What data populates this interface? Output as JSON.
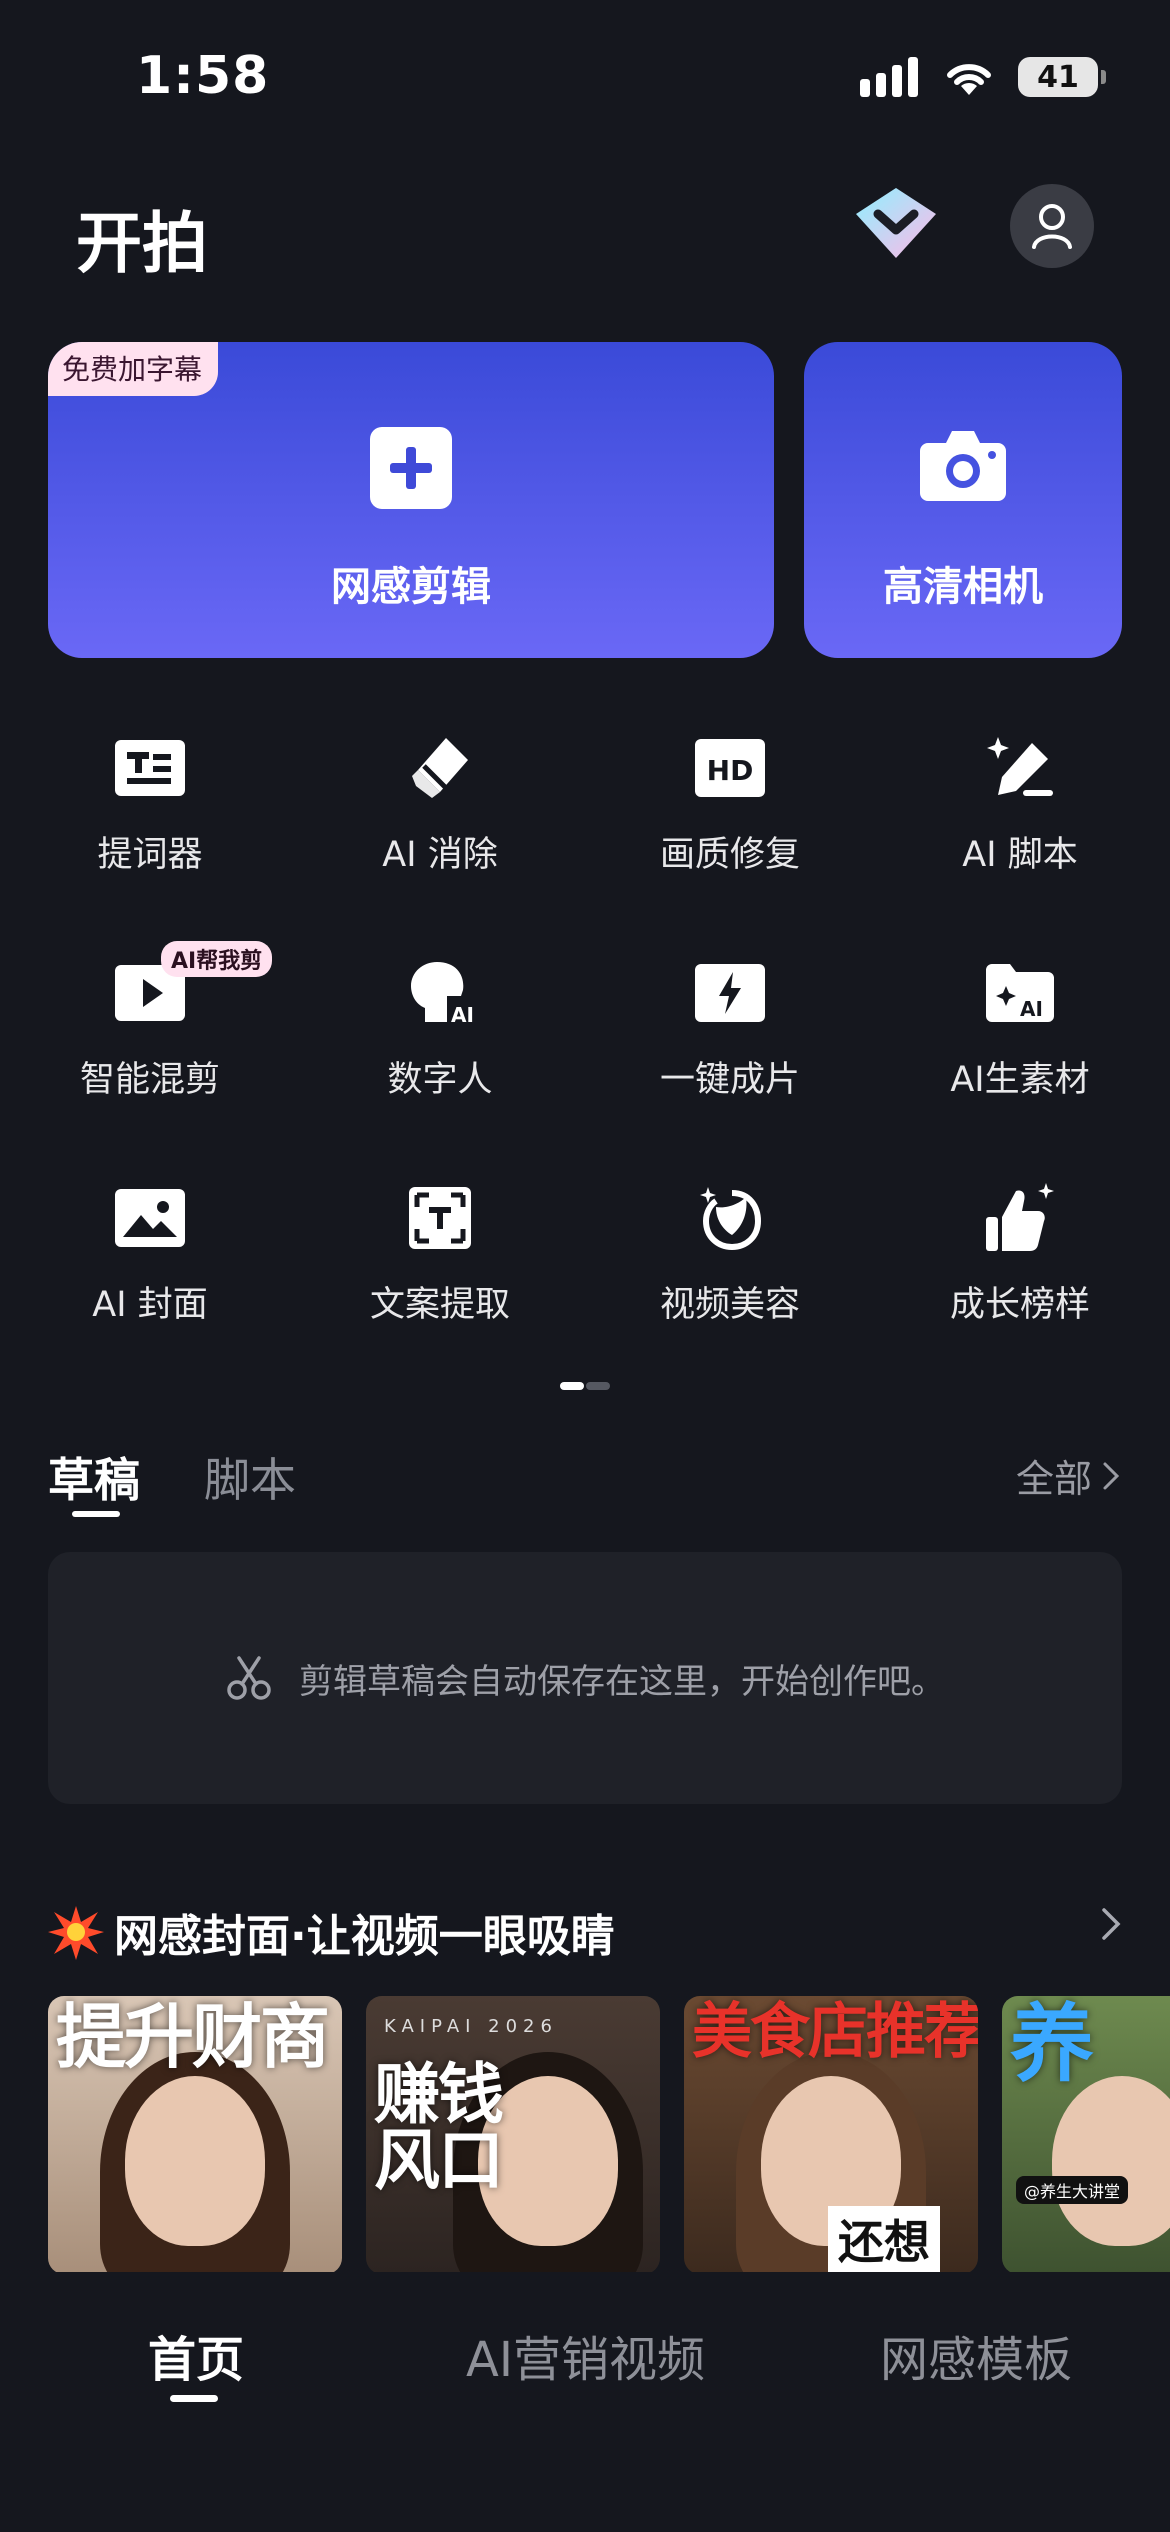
{
  "status_bar": {
    "time": "1:58",
    "battery": "41"
  },
  "header": {
    "title": "开拍"
  },
  "main_cards": {
    "edit": {
      "label": "网感剪辑",
      "badge": "免费加字幕"
    },
    "camera": {
      "label": "高清相机"
    }
  },
  "tools": [
    {
      "label": "提词器",
      "icon": "teleprompter-icon"
    },
    {
      "label": "AI 消除",
      "icon": "eraser-icon"
    },
    {
      "label": "画质修复",
      "icon": "hd-icon"
    },
    {
      "label": "AI 脚本",
      "icon": "magic-pen-icon"
    },
    {
      "label": "智能混剪",
      "icon": "play-icon",
      "badge": "AI帮我剪"
    },
    {
      "label": "数字人",
      "icon": "digital-human-icon"
    },
    {
      "label": "一键成片",
      "icon": "lightning-icon"
    },
    {
      "label": "AI生素材",
      "icon": "ai-folder-icon"
    },
    {
      "label": "AI 封面",
      "icon": "image-icon"
    },
    {
      "label": "文案提取",
      "icon": "text-extract-icon"
    },
    {
      "label": "视频美容",
      "icon": "beauty-icon"
    },
    {
      "label": "成长榜样",
      "icon": "thumbs-up-icon"
    }
  ],
  "drafts": {
    "tab_drafts": "草稿",
    "tab_script": "脚本",
    "see_all": "全部",
    "empty_text": "剪辑草稿会自动保存在这里，开始创作吧。"
  },
  "cover_section": {
    "title": "网感封面·让视频一眼吸睛",
    "thumbnails": [
      {
        "title": "提升财商"
      },
      {
        "title": "赚钱风口",
        "tag": "KAIPAI 2026"
      },
      {
        "title": "美食店推荐",
        "subtitle": "还想"
      },
      {
        "title": "养",
        "tag": "@养生大讲堂"
      }
    ]
  },
  "bottom_nav": {
    "home": "首页",
    "ai_video": "AI营销视频",
    "templates": "网感模板"
  }
}
